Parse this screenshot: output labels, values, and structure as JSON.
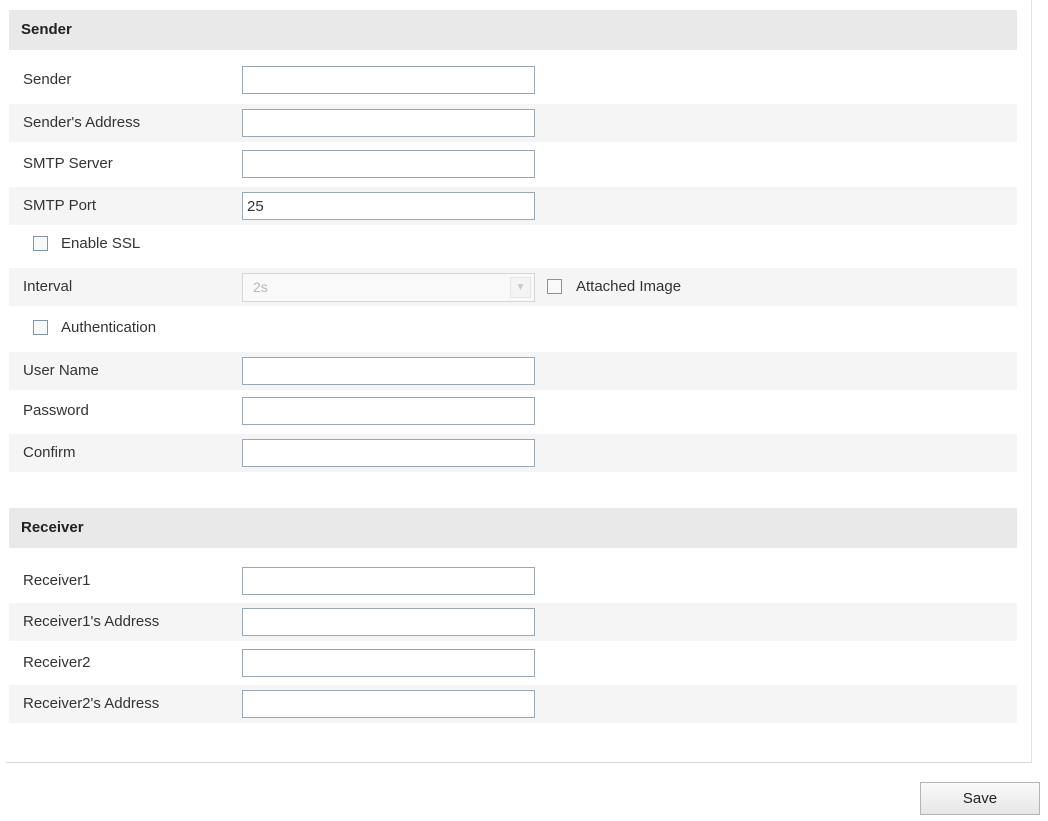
{
  "sender_section": {
    "title": "Sender",
    "fields": [
      {
        "label": "Sender",
        "value": ""
      },
      {
        "label": "Sender's Address",
        "value": ""
      },
      {
        "label": "SMTP Server",
        "value": ""
      },
      {
        "label": "SMTP Port",
        "value": "25"
      }
    ],
    "enable_ssl": {
      "label": "Enable SSL",
      "checked": false
    },
    "interval": {
      "label": "Interval",
      "value": "2s",
      "disabled": true
    },
    "attached_image": {
      "label": "Attached Image",
      "checked": false
    },
    "authentication": {
      "label": "Authentication",
      "checked": false
    },
    "auth_fields": [
      {
        "label": "User Name",
        "value": ""
      },
      {
        "label": "Password",
        "value": ""
      },
      {
        "label": "Confirm",
        "value": ""
      }
    ]
  },
  "receiver_section": {
    "title": "Receiver",
    "fields": [
      {
        "label": "Receiver1",
        "value": ""
      },
      {
        "label": "Receiver1's Address",
        "value": ""
      },
      {
        "label": "Receiver2",
        "value": ""
      },
      {
        "label": "Receiver2's Address",
        "value": ""
      }
    ]
  },
  "actions": {
    "save_label": "Save"
  },
  "colors": {
    "header_bg": "#e9e9e9",
    "alt_row_bg": "#f5f5f5",
    "input_border": "#9aa7b4",
    "checkbox_border": "#7f95ad"
  }
}
